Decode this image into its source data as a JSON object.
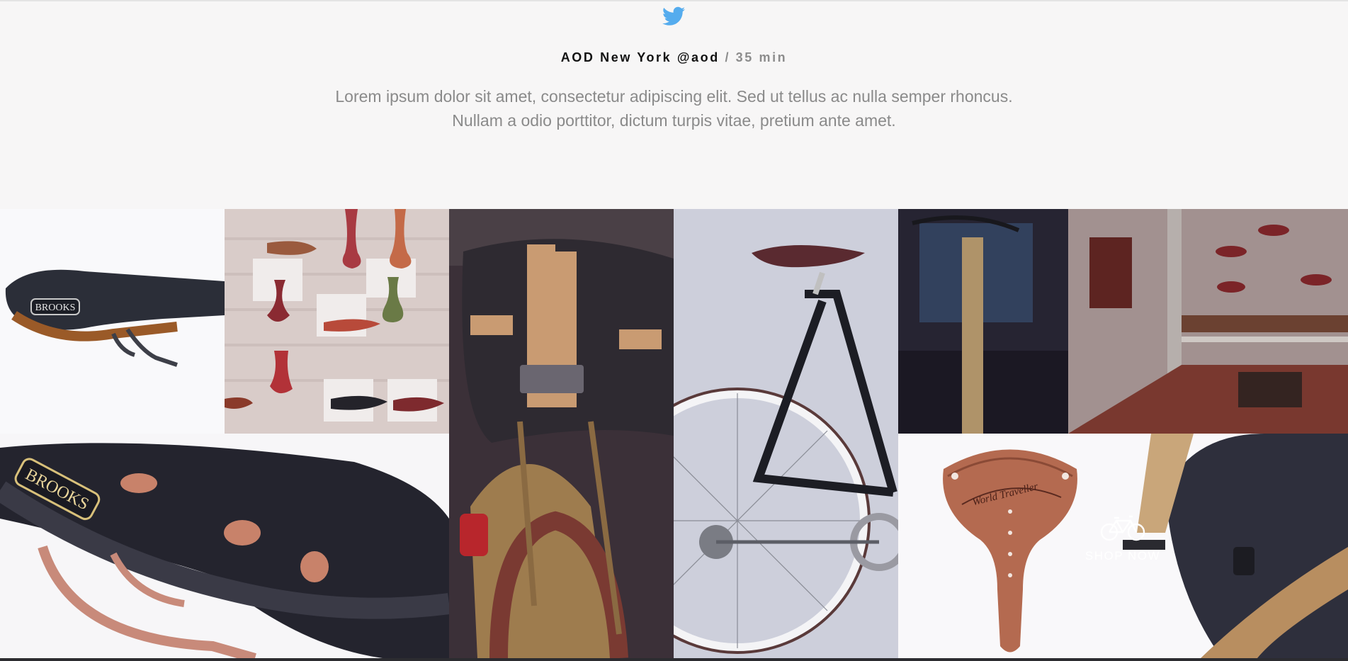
{
  "tweet": {
    "account": "AOD New York @aod",
    "separator": "/",
    "time": "35 min",
    "text_line1": "Lorem ipsum dolor sit amet, consectetur adipiscing elit. Sed ut tellus ac nulla semper rhoncus.",
    "text_line2": "Nullam a odio porttitor, dictum turpis vitae, pretium ante amet.",
    "icon": "twitter-bird-icon",
    "accent_color": "#55acee"
  },
  "gallery": {
    "shop_label": "SHOP NOW",
    "shop_icon": "bicycle-icon",
    "tiles": [
      "brooks-saddle-side-photo",
      "saddle-wall-display-photo",
      "bicycle-bag-rack-photo",
      "road-bicycle-photo",
      "store-interior-photo",
      "brooks-saddle-closeup-photo",
      "copper-world-traveller-saddle-photo",
      "canvas-messenger-bag-photo"
    ]
  }
}
